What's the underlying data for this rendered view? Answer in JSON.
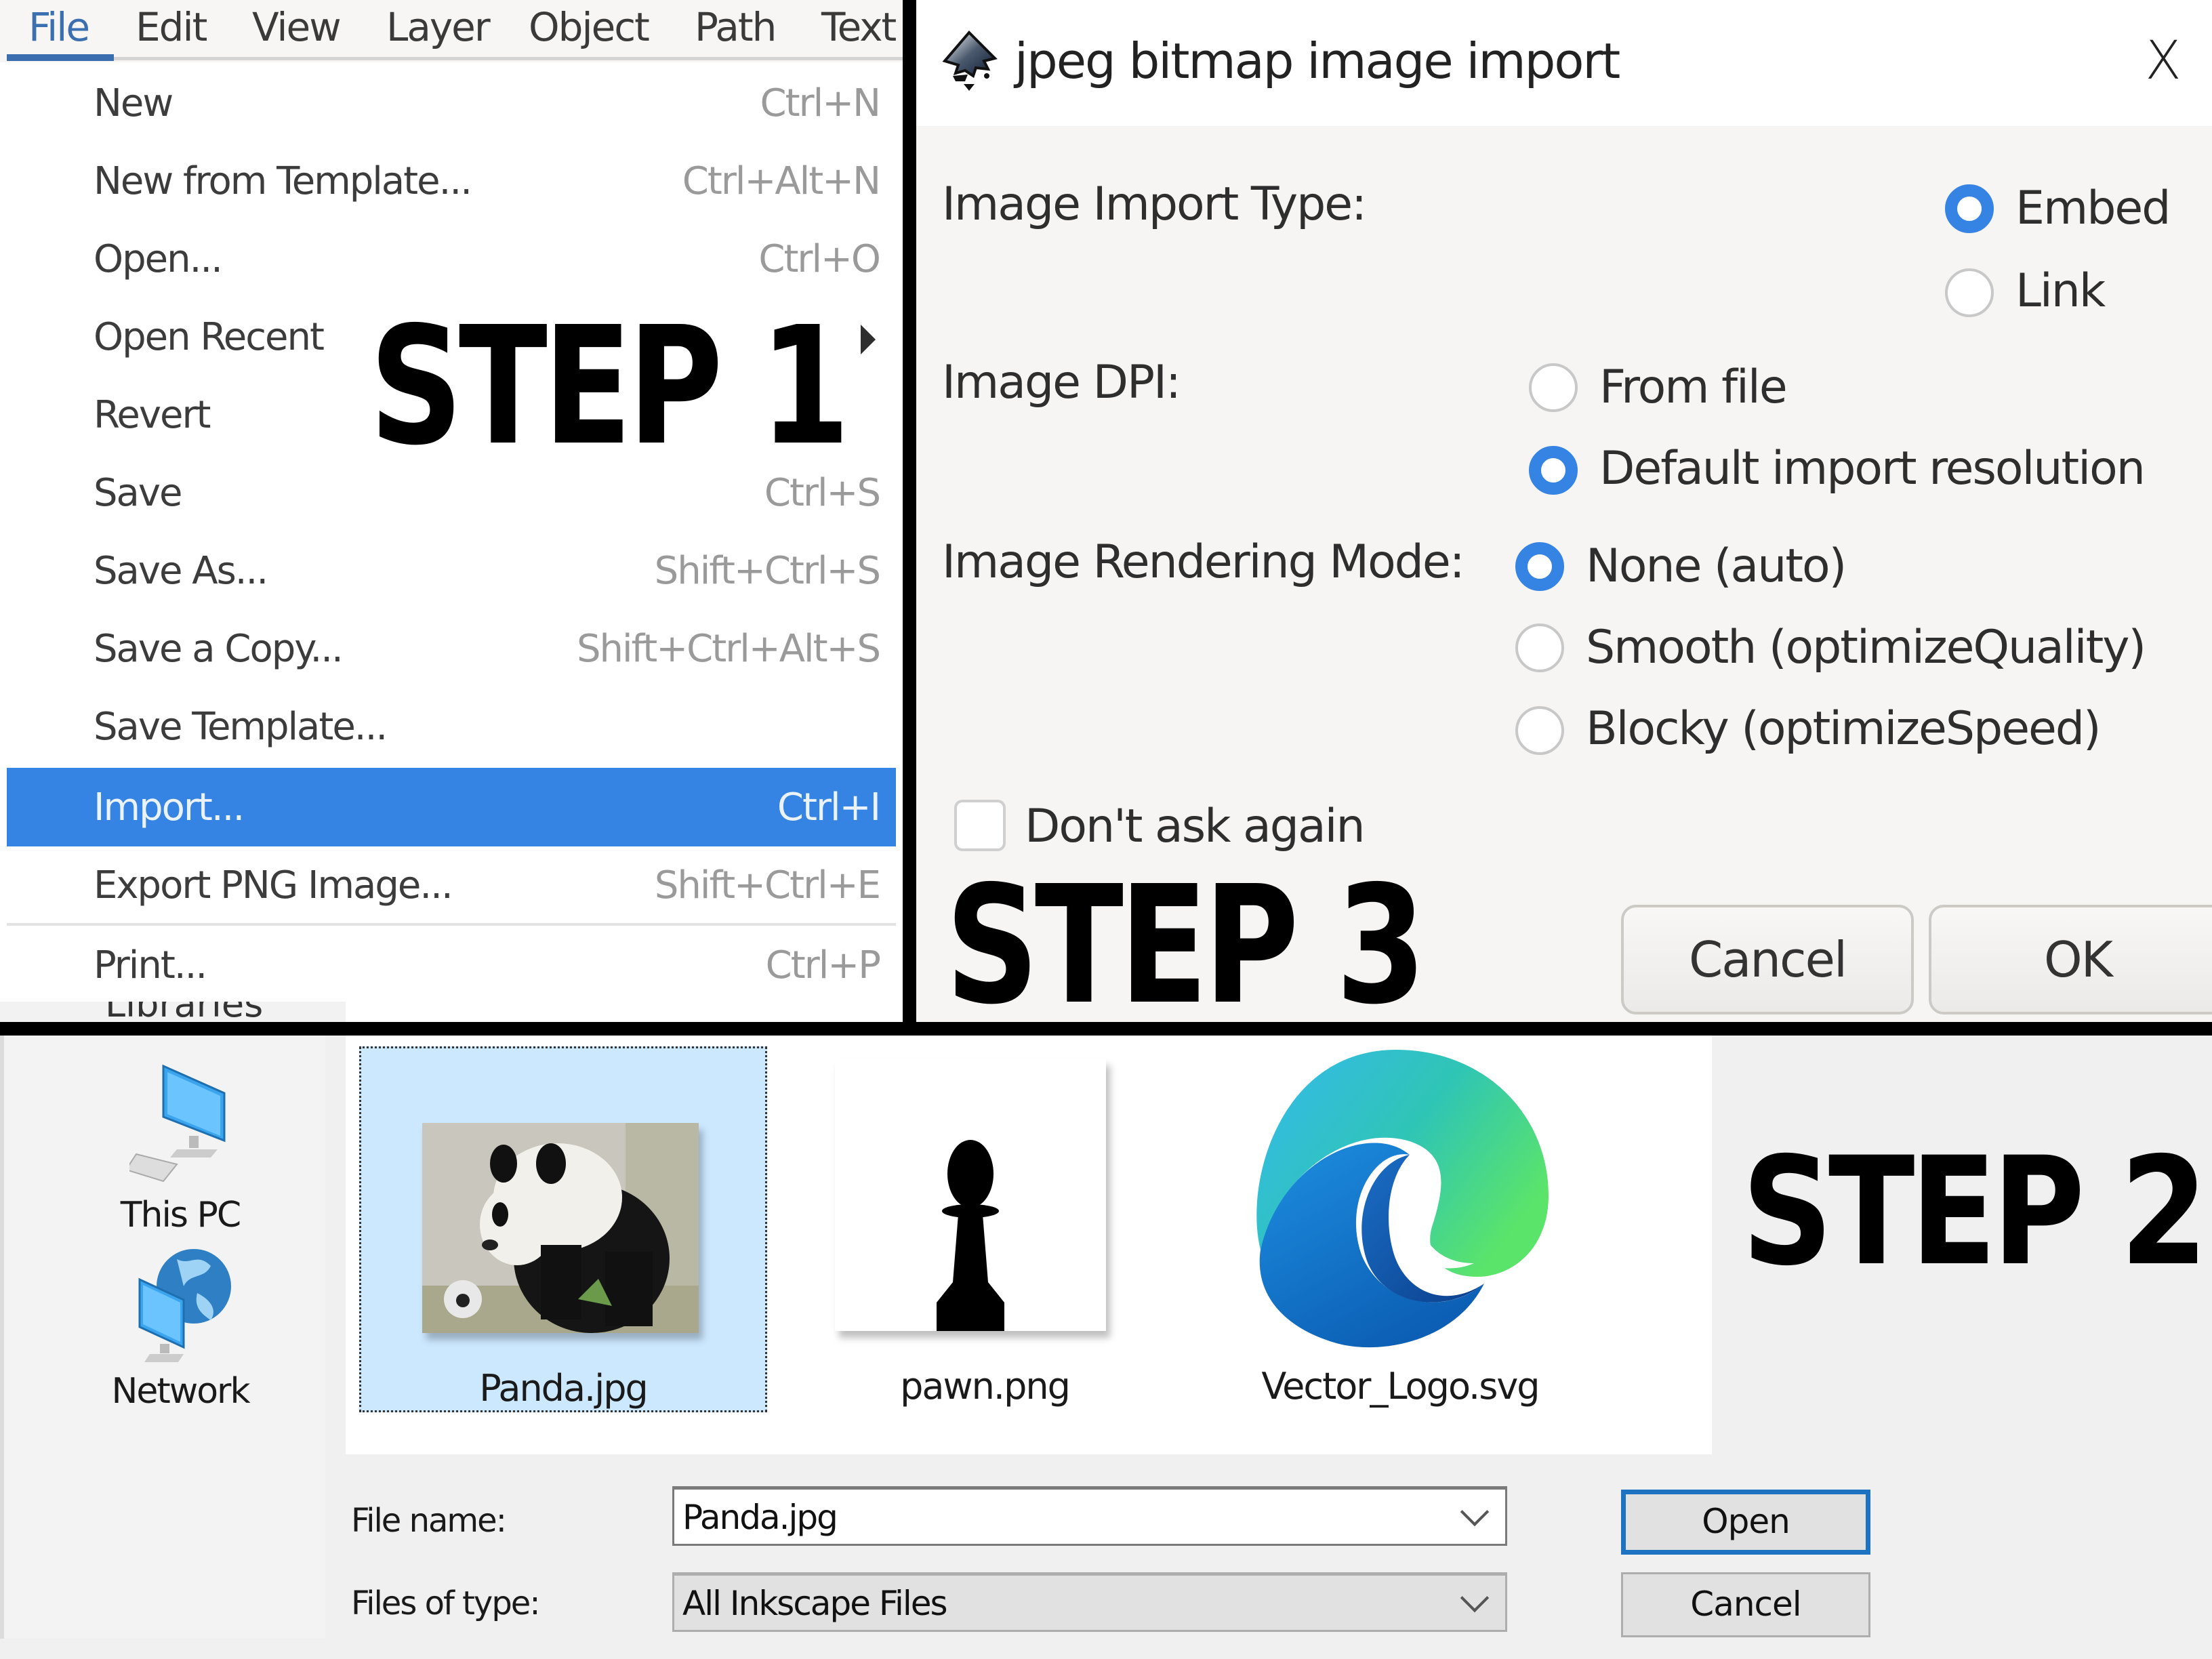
{
  "steps": {
    "step1": "STEP 1",
    "step2": "STEP 2",
    "step3": "STEP 3"
  },
  "menubar": {
    "items": [
      "File",
      "Edit",
      "View",
      "Layer",
      "Object",
      "Path",
      "Text"
    ],
    "active": "File"
  },
  "file_menu": {
    "items": [
      {
        "label": "New",
        "shortcut": "Ctrl+N"
      },
      {
        "label": "New from Template...",
        "shortcut": "Ctrl+Alt+N"
      },
      {
        "label": "Open...",
        "shortcut": "Ctrl+O"
      },
      {
        "label": "Open Recent",
        "shortcut": "",
        "submenu": true
      },
      {
        "label": "Revert",
        "shortcut": ""
      },
      {
        "label": "Save",
        "shortcut": "Ctrl+S"
      },
      {
        "label": "Save As...",
        "shortcut": "Shift+Ctrl+S"
      },
      {
        "label": "Save a Copy...",
        "shortcut": "Shift+Ctrl+Alt+S"
      },
      {
        "label": "Save Template...",
        "shortcut": ""
      },
      {
        "label": "Import...",
        "shortcut": "Ctrl+I",
        "highlighted": true
      },
      {
        "label": "Export PNG Image...",
        "shortcut": "Shift+Ctrl+E"
      },
      {
        "label": "Print...",
        "shortcut": "Ctrl+P"
      }
    ],
    "highlight_color": "#3584e4"
  },
  "background_partial_text": "Libraries",
  "import_dialog": {
    "title": "jpeg bitmap image import",
    "icon": "inkscape-icon",
    "close_label": "X",
    "import_type": {
      "label": "Image Import Type:",
      "options": [
        "Embed",
        "Link"
      ],
      "selected": "Embed"
    },
    "dpi": {
      "label": "Image DPI:",
      "options": [
        "From file",
        "Default import resolution"
      ],
      "selected": "Default import resolution"
    },
    "rendering_mode": {
      "label": "Image Rendering Mode:",
      "options": [
        "None (auto)",
        "Smooth (optimizeQuality)",
        "Blocky (optimizeSpeed)"
      ],
      "selected": "None (auto)"
    },
    "dont_ask_again": {
      "label": "Don't ask again",
      "checked": false
    },
    "buttons": {
      "cancel": "Cancel",
      "ok": "OK"
    },
    "accent_color": "#3584e4"
  },
  "open_dialog": {
    "nav_items": [
      {
        "label": "This PC",
        "icon": "computer-icon"
      },
      {
        "label": "Network",
        "icon": "network-icon"
      }
    ],
    "files": [
      {
        "name": "Panda.jpg",
        "thumbnail": "panda-photo",
        "selected": true
      },
      {
        "name": "pawn.png",
        "thumbnail": "chess-pawn"
      },
      {
        "name": "Vector_Logo.svg",
        "thumbnail": "edge-logo"
      }
    ],
    "file_name_label": "File name:",
    "file_name_value": "Panda.jpg",
    "file_type_label": "Files of type:",
    "file_type_value": "All Inkscape Files",
    "buttons": {
      "open": "Open",
      "cancel": "Cancel"
    },
    "selection_color": "#cce8ff",
    "default_button_border": "#1e72c2"
  }
}
